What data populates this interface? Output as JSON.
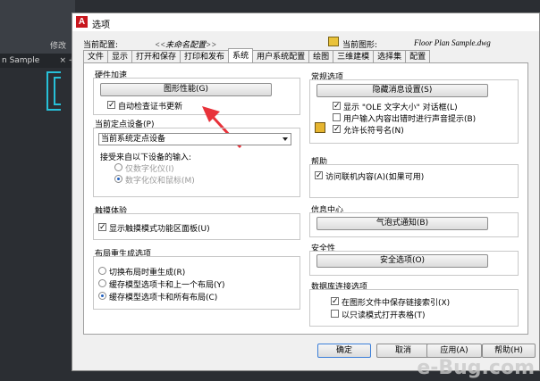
{
  "background": {
    "tab_label": "n Sample",
    "tab_close": "×",
    "tab_add": "+",
    "module_label": "修改"
  },
  "dialog": {
    "title": "选项",
    "icon_letter": "A",
    "current_profile_label": "当前配置:",
    "current_profile_value": "<<未命名配置>>",
    "current_drawing_label": "当前图形:",
    "current_drawing_value": "Floor Plan Sample.dwg",
    "tabs": [
      "文件",
      "显示",
      "打开和保存",
      "打印和发布",
      "系统",
      "用户系统配置",
      "绘图",
      "三维建模",
      "选择集",
      "配置"
    ],
    "left": {
      "hardware": {
        "title": "硬件加速",
        "graphics_button": "图形性能(G)",
        "auto_check": "自动检查证书更新",
        "auto_check_checked": "✓"
      },
      "pointing": {
        "title": "当前定点设备(P)",
        "select_value": "当前系统定点设备",
        "accept_label": "接受来自以下设备的输入:",
        "radio1": "仅数字化仪(I)",
        "radio2": "数字化仪和鼠标(M)"
      },
      "touch": {
        "title": "触摸体验",
        "show_touch": "显示触摸模式功能区面板(U)",
        "show_touch_checked": "✓"
      },
      "layout": {
        "title": "布局重生成选项",
        "radio1": "切换布局时重生成(R)",
        "radio2": "缓存模型选项卡和上一个布局(Y)",
        "radio3": "缓存模型选项卡和所有布局(C)"
      }
    },
    "right": {
      "general": {
        "title": "常规选项",
        "hidden_msg_button": "隐藏消息设置(S)",
        "ole_dialog": "显示 \"OLE 文字大小\" 对话框(L)",
        "ole_checked": "✓",
        "beep": "用户输入内容出错时进行声音提示(B)",
        "long_names": "允许长符号名(N)",
        "long_names_checked": "✓"
      },
      "help": {
        "title": "帮助",
        "online": "访问联机内容(A)(如果可用)",
        "online_checked": "✓"
      },
      "info_center": {
        "title": "信息中心",
        "balloon_button": "气泡式通知(B)"
      },
      "security": {
        "title": "安全性",
        "security_button": "安全选项(O)"
      },
      "db": {
        "title": "数据库连接选项",
        "store_links": "在图形文件中保存链接索引(X)",
        "store_links_checked": "✓",
        "readonly": "以只读模式打开表格(T)"
      }
    },
    "buttons": {
      "ok": "确定",
      "cancel": "取消",
      "apply": "应用(A)",
      "help": "帮助(H)"
    }
  },
  "watermark": "e-Bug.com",
  "colors": {
    "annotation_arrow": "#e8323a",
    "accent_blue": "#1f5fbf",
    "brand_red": "#c8161d"
  }
}
